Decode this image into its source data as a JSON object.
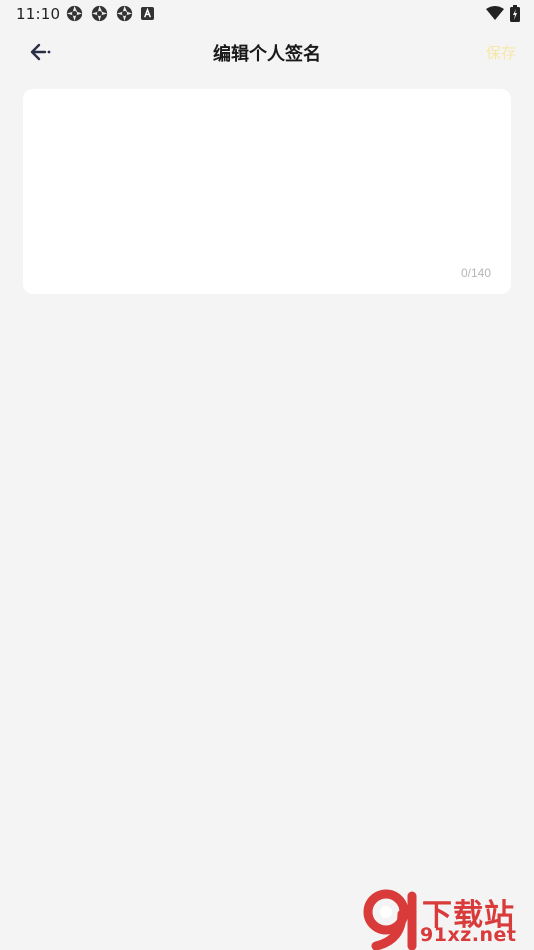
{
  "status_bar": {
    "time": "11:10",
    "left_icons": [
      "aperture-icon",
      "aperture-icon",
      "aperture-icon",
      "a-box-icon"
    ],
    "right_icons": [
      "wifi-icon",
      "battery-charging-icon"
    ]
  },
  "header": {
    "title": "编辑个人签名",
    "save_label": "保存",
    "back_icon": "arrow-left-icon"
  },
  "signature": {
    "value": "",
    "placeholder": "",
    "counter": "0/140"
  },
  "watermark": {
    "brand_cn": "下载站",
    "brand_en": "91xz.net"
  },
  "colors": {
    "background": "#f4f4f5",
    "card": "#ffffff",
    "save_disabled": "#f7e7a6",
    "watermark": "#d93a3a"
  }
}
